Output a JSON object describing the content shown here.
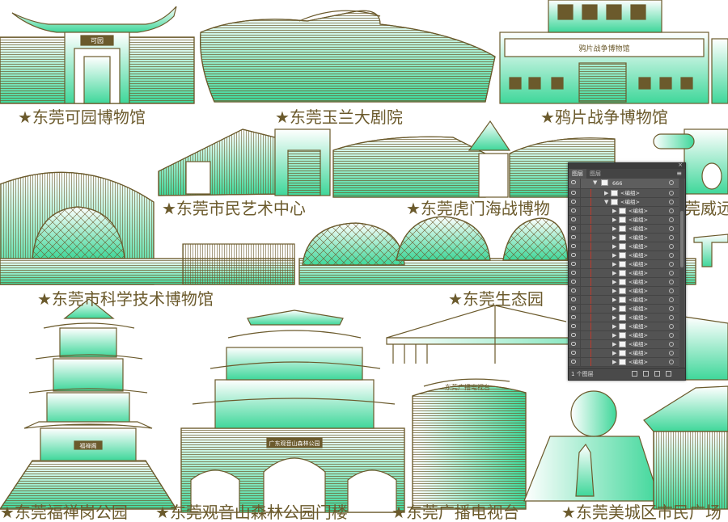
{
  "canvas": {
    "background": "#ffffff",
    "ink": "#6b5a2c",
    "accent_green": "#3fd79a"
  },
  "labels": [
    "★东莞可园博物馆",
    "★东莞玉兰大剧院",
    "★鸦片战争博物馆",
    "★东莞市民艺术中心",
    "★东莞虎门海战博物",
    "莞威远",
    "★东莞市科学技术博物馆",
    "★东莞生态园",
    "★东莞福禅岗公园",
    "★东莞观音山森林公园门楼",
    "★东莞广播电视台",
    "★东莞美城区市民广场"
  ],
  "building_signs": {
    "keyuan": "可园",
    "opium_war": "鸦片战争博物馆",
    "guanyin_gate": "广东观音山森林公园",
    "tv_tower": "东莞广播电视台",
    "fuchan_pagoda": "福禅阁"
  },
  "layers_panel": {
    "tab_label": "图层",
    "tab_label2": "图层",
    "top_layer": "666",
    "group_label": "<编组>",
    "item_label": "<编组>",
    "footer_count": "1 个图层",
    "menu_glyph": "≡",
    "close_glyph": "×",
    "row_count": 20
  }
}
